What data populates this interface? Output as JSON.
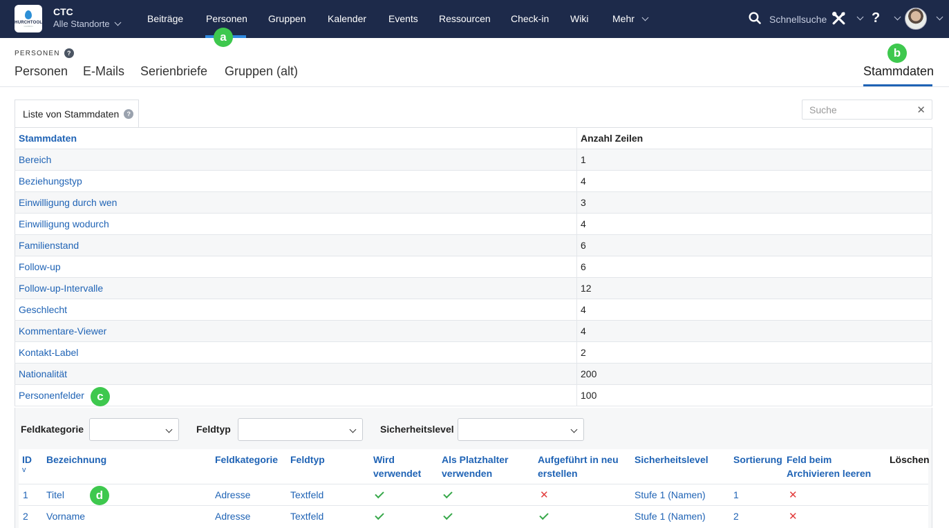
{
  "app": {
    "org": "CTC",
    "location": "Alle Standorte",
    "logo_text": "CHURCHTOOLS",
    "logo_sub": "CHURCH"
  },
  "nav": {
    "items": [
      "Beiträge",
      "Personen",
      "Gruppen",
      "Kalender",
      "Events",
      "Ressourcen",
      "Check-in",
      "Wiki",
      "Mehr"
    ],
    "search_label": "Schnellsuche",
    "help": "?"
  },
  "badges": {
    "a": "a",
    "b": "b",
    "c": "c",
    "d": "d"
  },
  "colors": {
    "nav_bg": "#1d2a4a",
    "accent": "#2f8ae0",
    "link": "#1f63b5",
    "badge": "#3ec84e",
    "check": "#37a84a",
    "cross": "#e23b3b"
  },
  "section": {
    "label": "PERSONEN",
    "help": "?"
  },
  "subtabs": [
    "Personen",
    "E-Mails",
    "Serienbriefe",
    "Gruppen (alt)"
  ],
  "active_subtab": "Stammdaten",
  "panel": {
    "tab_label": "Liste von Stammdaten",
    "help": "?",
    "search_placeholder": "Suche",
    "clear": "✕"
  },
  "grid": {
    "headers": [
      "Stammdaten",
      "Anzahl Zeilen"
    ],
    "rows": [
      [
        "Bereich",
        "1"
      ],
      [
        "Beziehungstyp",
        "4"
      ],
      [
        "Einwilligung durch wen",
        "3"
      ],
      [
        "Einwilligung wodurch",
        "4"
      ],
      [
        "Familienstand",
        "6"
      ],
      [
        "Follow-up",
        "6"
      ],
      [
        "Follow-up-Intervalle",
        "12"
      ],
      [
        "Geschlecht",
        "4"
      ],
      [
        "Kommentare-Viewer",
        "4"
      ],
      [
        "Kontakt-Label",
        "2"
      ],
      [
        "Nationalität",
        "200"
      ],
      [
        "Personenfelder",
        "100"
      ]
    ]
  },
  "filters": {
    "feldkategorie": "Feldkategorie",
    "feldtyp": "Feldtyp",
    "sicherheitslevel": "Sicherheitslevel"
  },
  "detail": {
    "headers": [
      "ID",
      "Bezeichnung",
      "Feldkategorie",
      "Feldtyp",
      "Wird verwendet",
      "Als Platzhalter verwenden",
      "Aufgeführt in neu erstellen",
      "Sicherheitslevel",
      "Sortierung",
      "Feld beim Archivieren leeren",
      "Löschen"
    ],
    "sort_indicator": "v",
    "rows": [
      {
        "id": "1",
        "name": "Titel",
        "kategorie": "Adresse",
        "typ": "Textfeld",
        "verwendet": true,
        "platzhalter": true,
        "neu": false,
        "level": "Stufe 1 (Namen)",
        "sortierung": "1",
        "archiv": false
      },
      {
        "id": "2",
        "name": "Vorname",
        "kategorie": "Adresse",
        "typ": "Textfeld",
        "verwendet": true,
        "platzhalter": true,
        "neu": true,
        "level": "Stufe 1 (Namen)",
        "sortierung": "2",
        "archiv": false
      }
    ]
  }
}
